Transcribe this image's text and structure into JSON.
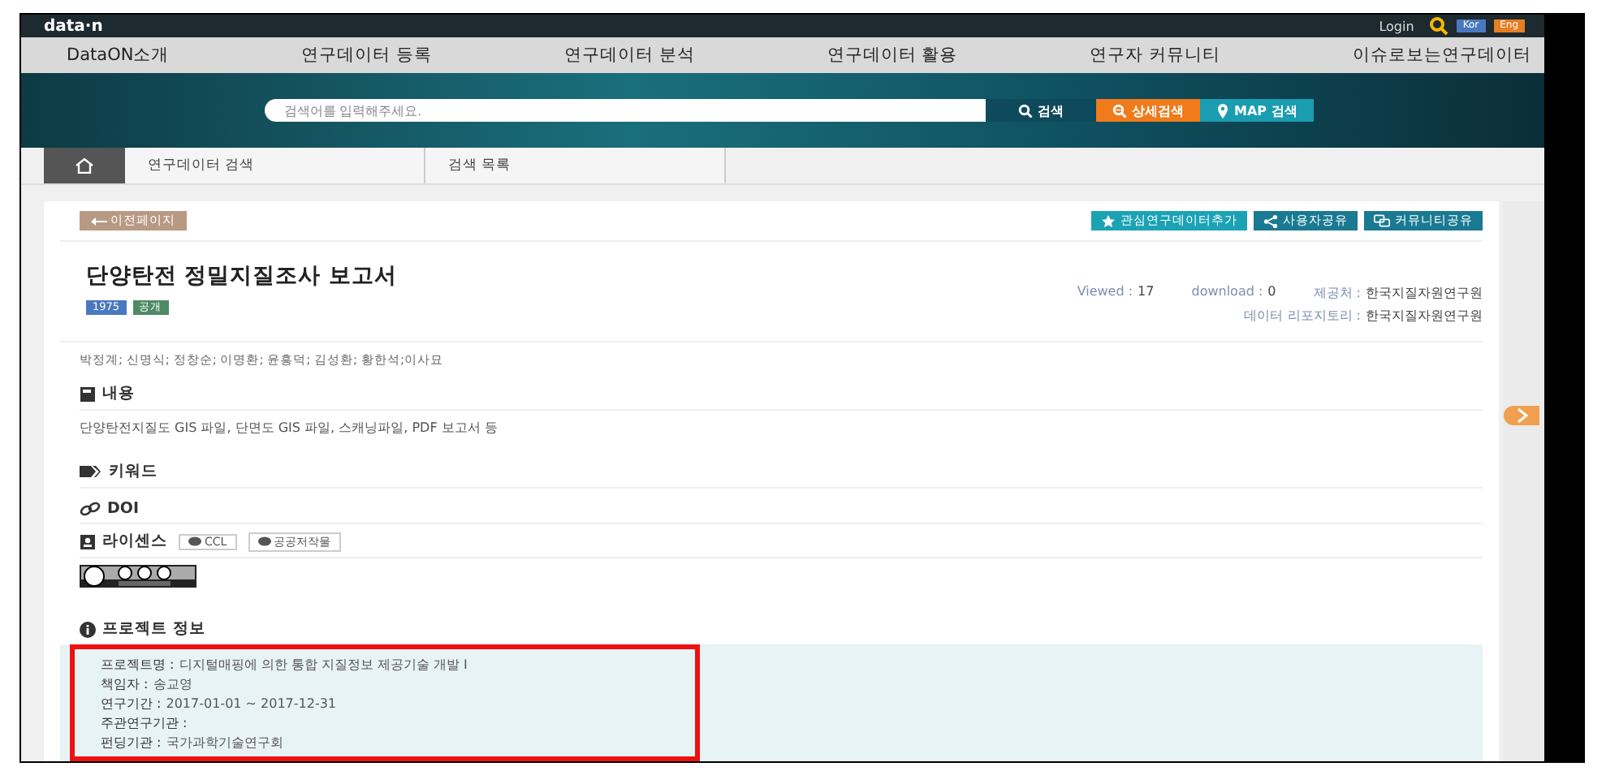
{
  "header": {
    "logo": "data·n",
    "login": "Login",
    "languages": [
      {
        "label": "Kor",
        "color": "#4a78c0"
      },
      {
        "label": "Eng",
        "color": "#e67e22"
      }
    ]
  },
  "nav": [
    "DataON소개",
    "연구데이터 등록",
    "연구데이터 분석",
    "연구데이터 활용",
    "연구자 커뮤니티",
    "이슈로보는연구데이터"
  ],
  "search": {
    "placeholder": "검색어를 입력해주세요.",
    "buttons": [
      {
        "label": "검색",
        "kind": "search"
      },
      {
        "label": "상세검색",
        "kind": "detail"
      },
      {
        "label": "MAP 검색",
        "kind": "map"
      }
    ]
  },
  "breadcrumb": [
    "연구데이터 검색",
    "검색 목록"
  ],
  "back_button": "이전페이지",
  "actions": [
    {
      "label": "관심연구데이터추가",
      "kind": "star"
    },
    {
      "label": "사용자공유",
      "kind": "share"
    },
    {
      "label": "커뮤니티공유",
      "kind": "community"
    }
  ],
  "title": "단양탄전 정밀지질조사 보고서",
  "badges": [
    {
      "label": "1975",
      "color": "#4a78c0"
    },
    {
      "label": "공개",
      "color": "#4e8a64"
    }
  ],
  "stats": {
    "viewed_label": "Viewed :",
    "viewed": "17",
    "download_label": "download :",
    "download": "0",
    "provider_label": "제공처 :",
    "provider": "한국지질자원연구원",
    "repository_label": "데이터 리포지토리 :",
    "repository": "한국지질자원연구원"
  },
  "authors": "박정계; 신명식; 정창순; 이명환; 윤흥덕; 김성환; 황한석;이사묘",
  "sections": [
    {
      "title": "내용",
      "kind": "content",
      "text": "단양탄전지질도 GIS 파일, 단면도 GIS 파일, 스캐닝파일, PDF 보고서 등"
    },
    {
      "title": "키워드",
      "kind": "keyword"
    },
    {
      "title": "DOI",
      "kind": "doi"
    },
    {
      "title": "라이센스",
      "kind": "license",
      "tags": [
        "CCL",
        "공공저작물"
      ]
    }
  ],
  "project": {
    "title": "프로젝트 정보",
    "highlighted": true,
    "fields": [
      {
        "label": "프로젝트명 :",
        "value": "디지털매핑에 의한 통합 지질정보 제공기술 개발 I"
      },
      {
        "label": "책임자 :",
        "value": "송교영"
      },
      {
        "label": "연구기간 :",
        "value": "2017-01-01 ~ 2017-12-31"
      },
      {
        "label": "주관연구기관 :"
      },
      {
        "label": "펀딩기관 :",
        "value": "국가과학기술연구회"
      }
    ]
  }
}
